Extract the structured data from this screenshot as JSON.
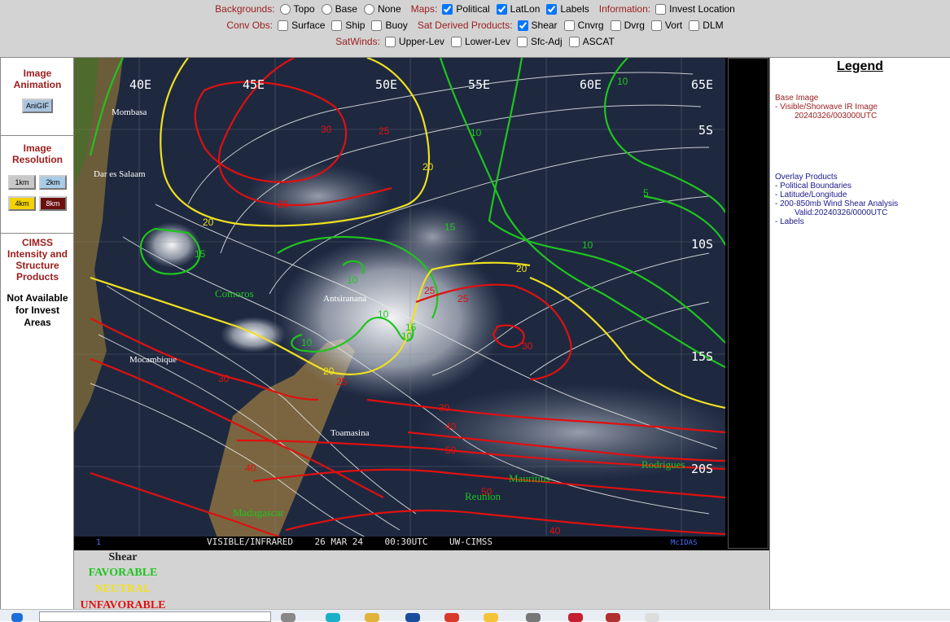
{
  "controls": {
    "row1": {
      "backgrounds_label": "Backgrounds:",
      "topo": "Topo",
      "base": "Base",
      "none": "None",
      "maps_label": "Maps:",
      "political": "Political",
      "latlon": "LatLon",
      "labels": "Labels",
      "information_label": "Information:",
      "invest_location": "Invest Location"
    },
    "row2": {
      "conv_obs_label": "Conv Obs:",
      "surface": "Surface",
      "ship": "Ship",
      "buoy": "Buoy",
      "sat_derived_label": "Sat Derived Products:",
      "shear": "Shear",
      "cnvrg": "Cnvrg",
      "dvrg": "Dvrg",
      "vort": "Vort",
      "dlm": "DLM"
    },
    "row3": {
      "satwinds_label": "SatWinds:",
      "upper_lev": "Upper-Lev",
      "lower_lev": "Lower-Lev",
      "sfc_adj": "Sfc-Adj",
      "ascat": "ASCAT"
    }
  },
  "left": {
    "anim_title": "Image Animation",
    "anigif": "AniGIF",
    "res_title": "Image Resolution",
    "res_1km": "1km",
    "res_2km": "2km",
    "res_4km": "4km",
    "res_8km": "8km",
    "cimss_title": "CIMSS Intensity and Structure Products",
    "not_available": "Not Available for Invest Areas"
  },
  "map": {
    "lon_labels": [
      "40E",
      "45E",
      "50E",
      "55E",
      "60E",
      "65E"
    ],
    "lat_labels": [
      "5S",
      "10S",
      "15S",
      "20S"
    ],
    "place_labels": [
      "Mombasa",
      "Dar es Salaam",
      "Comoros",
      "Antsiranana",
      "Mocambique",
      "Toamasina",
      "Madagascar",
      "Mauritius",
      "Reunion",
      "Rodrigues"
    ],
    "banner_index": "1",
    "banner_text": "VISIBLE/INFRARED    26 MAR 24    00:30UTC    UW-CIMSS",
    "banner_right": "McIDAS",
    "contour_colors": {
      "low": "#1fc41f",
      "mid": "#f0e020",
      "high": "#e01010"
    }
  },
  "shear_legend": {
    "title": "Shear",
    "favorable": "FAVORABLE",
    "neutral": "NEUTRAL",
    "unfavorable": "UNFAVORABLE",
    "colors": {
      "favorable": "#1fc41f",
      "neutral": "#f0e020",
      "unfavorable": "#e01010"
    }
  },
  "legend": {
    "title": "Legend",
    "base_image_head": "Base Image",
    "base_image_item": "-  Visible/Shorwave IR Image",
    "base_image_time": "20240326/003000UTC",
    "overlay_head": "Overlay Products",
    "ov1": "-  Political Boundaries",
    "ov2": "-  Latitude/Longitude",
    "ov3": "-  200-850mb Wind Shear Analysis",
    "ov3_valid": "Valid:20240326/0000UTC",
    "ov4": "-  Labels"
  }
}
